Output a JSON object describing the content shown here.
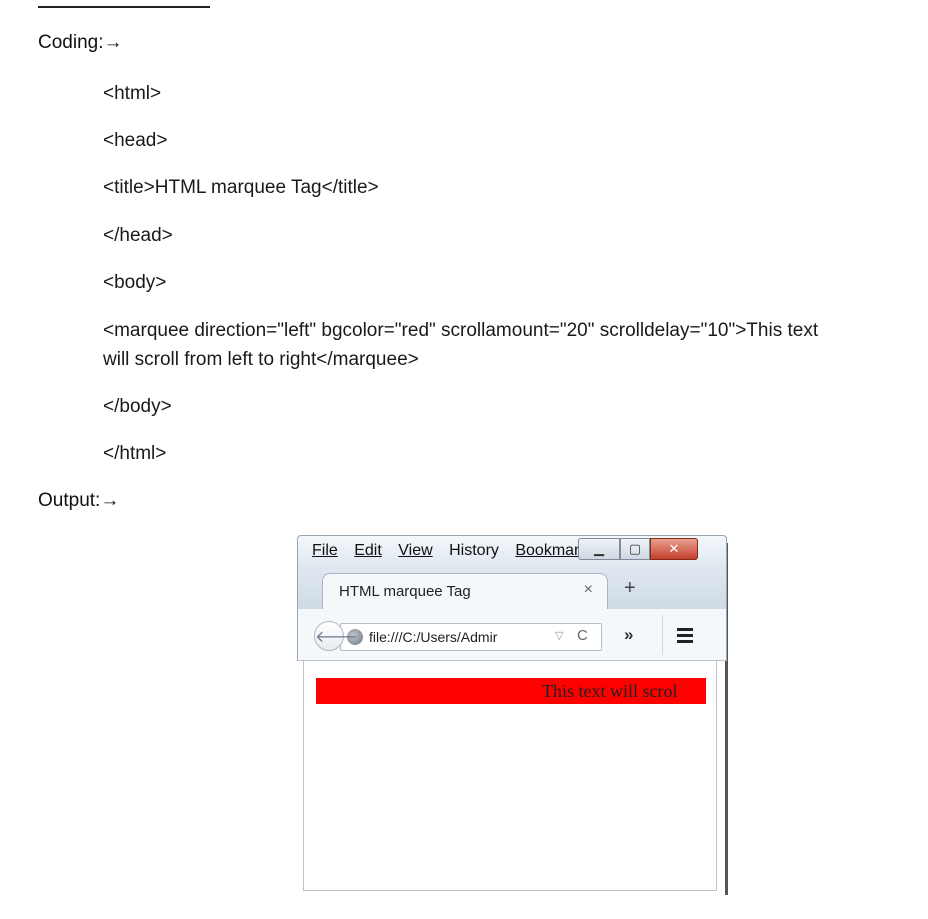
{
  "document": {
    "coding_heading": "Coding:→",
    "code_lines": [
      "<html>",
      "<head>",
      "<title>HTML marquee Tag</title>",
      "</head>",
      "<body>",
      "<marquee direction=\"left\" bgcolor=\"red\" scrollamount=\"20\" scrolldelay=\"10\">This text",
      "will scroll from left to right</marquee>",
      "</body>",
      "</html>"
    ],
    "output_heading": "Output:→"
  },
  "browser": {
    "menu": {
      "file": "File",
      "edit": "Edit",
      "view": "View",
      "history": "History",
      "bookmarks": "Bookmar"
    },
    "tab_title": "HTML marquee Tag",
    "tab_close": "×",
    "new_tab": "+",
    "url": "file:///C:/Users/Admir",
    "marquee_text": "This text will scrol",
    "marquee_color": "#ff0000",
    "icons": {
      "back": "back-arrow-icon",
      "globe": "globe-icon",
      "reload": "reload-icon",
      "overflow": "overflow-chevrons-icon",
      "menu": "hamburger-menu-icon"
    }
  }
}
